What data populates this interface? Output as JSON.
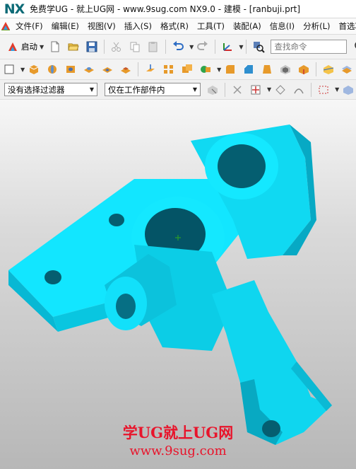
{
  "app": {
    "logo_text": "NX",
    "window_title": "免费学UG - 就上UG网 - www.9sug.com NX9.0 - 建模 - [ranbuji.prt]"
  },
  "menu": {
    "items": [
      "文件(F)",
      "编辑(E)",
      "视图(V)",
      "插入(S)",
      "格式(R)",
      "工具(T)",
      "装配(A)",
      "信息(I)",
      "分析(L)",
      "首选项"
    ]
  },
  "toolbar1": {
    "start_label": "启动",
    "search_placeholder": "查找命令"
  },
  "toolbar3": {
    "selection_filter": "没有选择过滤器",
    "selection_scope": "仅在工作部件内"
  },
  "viewport": {
    "model_color": "#00e5ff",
    "background_top": "#f7f7f7",
    "background_bottom": "#b7b7b7",
    "watermark_line1": "学UG就上UG网",
    "watermark_line2": "www.9sug.com",
    "watermark_color": "#e8142b"
  }
}
